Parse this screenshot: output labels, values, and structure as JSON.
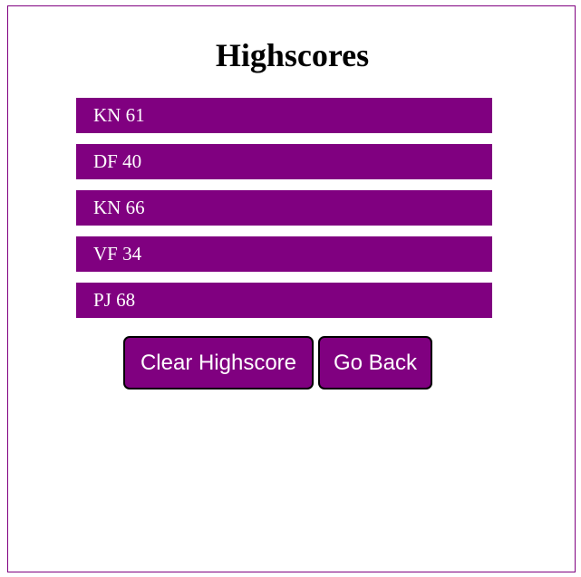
{
  "page": {
    "title": "Highscores"
  },
  "scores": [
    {
      "text": "KN 61"
    },
    {
      "text": "DF 40"
    },
    {
      "text": "KN 66"
    },
    {
      "text": "VF 34"
    },
    {
      "text": "PJ 68"
    }
  ],
  "buttons": {
    "clear_label": "Clear Highscore",
    "back_label": "Go Back"
  },
  "colors": {
    "accent": "#800080",
    "button_border": "#000000",
    "text_on_accent": "#ffffff"
  }
}
